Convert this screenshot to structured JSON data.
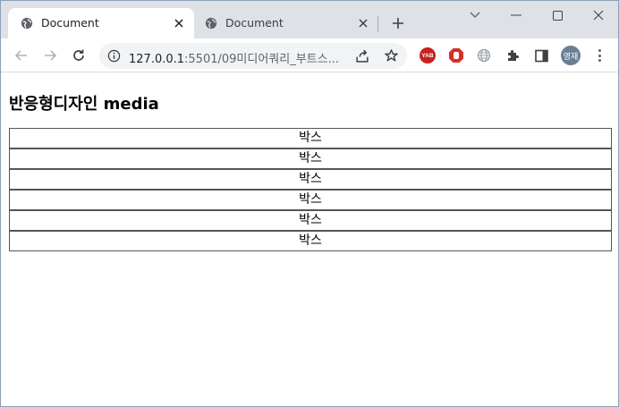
{
  "browser": {
    "tabs": [
      {
        "title": "Document",
        "active": true
      },
      {
        "title": "Document",
        "active": false
      }
    ],
    "address": {
      "host": "127.0.0.1",
      "path": ":5501/09미디어쿼리_부트스..."
    },
    "extensions": {
      "yab_label": "YAB"
    },
    "profile_initials": "영재"
  },
  "page": {
    "heading": "반응형디자인 media",
    "boxes": [
      {
        "label": "박스"
      },
      {
        "label": "박스"
      },
      {
        "label": "박스"
      },
      {
        "label": "박스"
      },
      {
        "label": "박스"
      },
      {
        "label": "박스"
      }
    ]
  },
  "colors": {
    "tabstrip_bg": "#dee1e6",
    "omnibox_bg": "#f1f3f4",
    "box_border": "#555555",
    "yab_red": "#c5221f",
    "stop_red": "#d93025",
    "profile_bg": "#6a7f93"
  },
  "icons": {
    "tab_favicon": "globe-icon",
    "tab_close": "close-icon",
    "new_tab": "plus-icon",
    "back": "arrow-left-icon",
    "forward": "arrow-right-icon",
    "reload": "reload-icon",
    "site_info": "info-icon",
    "share": "share-icon",
    "bookmark": "star-icon",
    "extensions": "puzzle-icon",
    "side_panel": "side-panel-icon",
    "menu": "kebab-menu-icon"
  }
}
